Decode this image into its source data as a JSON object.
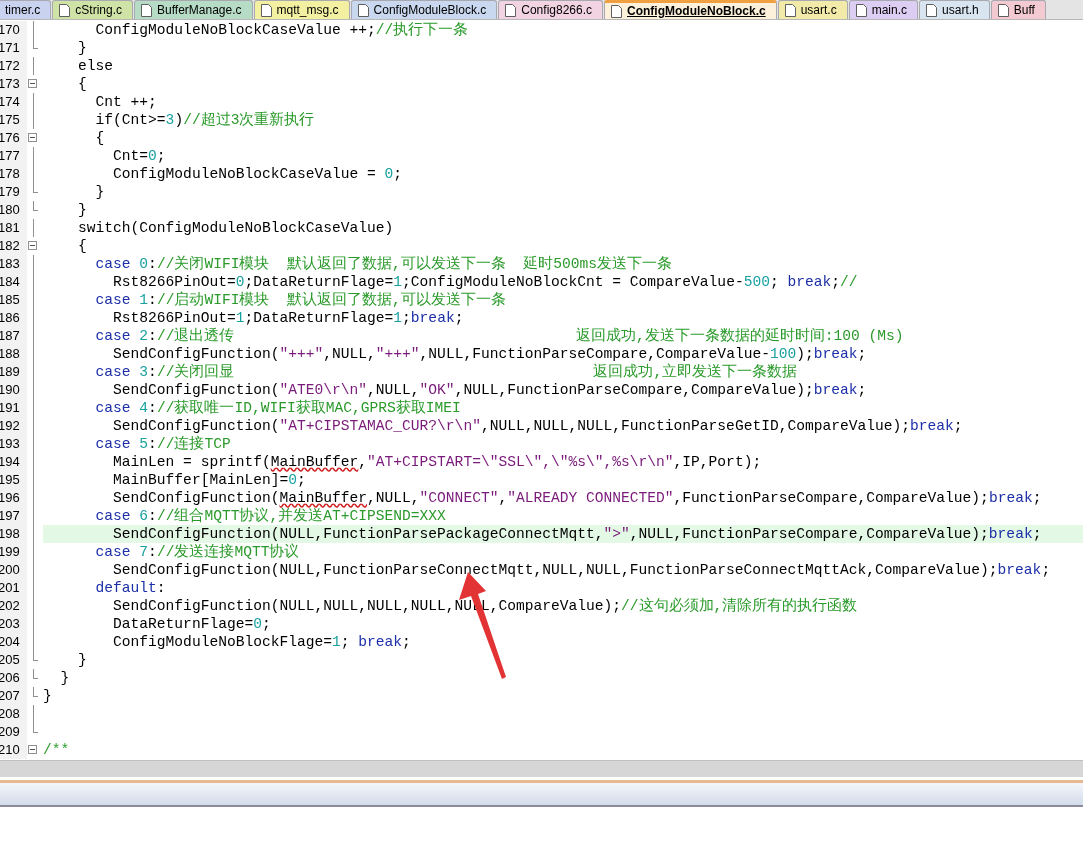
{
  "tabs": [
    {
      "label": "timer.c",
      "selected": false,
      "color": "#c9d3f0",
      "cut_left": true
    },
    {
      "label": "cString.c",
      "selected": false,
      "color": "#cfe3a6",
      "cut_left": false
    },
    {
      "label": "BufferManage.c",
      "selected": false,
      "color": "#b7dcc6",
      "cut_left": false
    },
    {
      "label": "mqtt_msg.c",
      "selected": false,
      "color": "#f3f0a2",
      "cut_left": false
    },
    {
      "label": "ConfigModuleBlock.c",
      "selected": false,
      "color": "#c9d8ef",
      "cut_left": false
    },
    {
      "label": "Config8266.c",
      "selected": false,
      "color": "#f1d3e2",
      "cut_left": false
    },
    {
      "label": "ConfigModuleNoBlock.c",
      "selected": true,
      "color": "#fdf1dc",
      "cut_left": false
    },
    {
      "label": "usart.c",
      "selected": false,
      "color": "#f2eaa9",
      "cut_left": false
    },
    {
      "label": "main.c",
      "selected": false,
      "color": "#dccdf2",
      "cut_left": false
    },
    {
      "label": "usart.h",
      "selected": false,
      "color": "#d9e4f1",
      "cut_left": false
    },
    {
      "label": "Buff",
      "selected": false,
      "color": "#f3c9d2",
      "cut_left": false
    }
  ],
  "editor": {
    "lines": [
      {
        "number": "170",
        "kind": "line",
        "highlighted": false,
        "segments": [
          {
            "kind": "code",
            "text": "      ConfigModuleNoBlockCaseValue ++;"
          },
          {
            "kind": "comment",
            "text": "//执行下一条"
          }
        ]
      },
      {
        "number": "171",
        "kind": "end",
        "highlighted": false,
        "segments": [
          {
            "kind": "code",
            "text": "    }"
          }
        ]
      },
      {
        "number": "172",
        "kind": "line",
        "highlighted": false,
        "segments": [
          {
            "kind": "code",
            "text": "    else"
          }
        ]
      },
      {
        "number": "173",
        "kind": "open",
        "highlighted": false,
        "segments": [
          {
            "kind": "code",
            "text": "    {"
          }
        ]
      },
      {
        "number": "174",
        "kind": "line",
        "highlighted": false,
        "segments": [
          {
            "kind": "code",
            "text": "      Cnt ++;"
          }
        ]
      },
      {
        "number": "175",
        "kind": "line",
        "highlighted": false,
        "segments": [
          {
            "kind": "code",
            "text": "      if(Cnt>="
          },
          {
            "kind": "number",
            "text": "3"
          },
          {
            "kind": "code",
            "text": ")"
          },
          {
            "kind": "comment",
            "text": "//超过3次重新执行"
          }
        ]
      },
      {
        "number": "176",
        "kind": "open",
        "highlighted": false,
        "segments": [
          {
            "kind": "code",
            "text": "      {"
          }
        ]
      },
      {
        "number": "177",
        "kind": "line",
        "highlighted": false,
        "segments": [
          {
            "kind": "code",
            "text": "        Cnt="
          },
          {
            "kind": "number",
            "text": "0"
          },
          {
            "kind": "code",
            "text": ";"
          }
        ]
      },
      {
        "number": "178",
        "kind": "line",
        "highlighted": false,
        "segments": [
          {
            "kind": "code",
            "text": "        ConfigModuleNoBlockCaseValue = "
          },
          {
            "kind": "number",
            "text": "0"
          },
          {
            "kind": "code",
            "text": ";"
          }
        ]
      },
      {
        "number": "179",
        "kind": "end",
        "highlighted": false,
        "segments": [
          {
            "kind": "code",
            "text": "      }"
          }
        ]
      },
      {
        "number": "180",
        "kind": "end",
        "highlighted": false,
        "segments": [
          {
            "kind": "code",
            "text": "    }"
          }
        ]
      },
      {
        "number": "181",
        "kind": "line",
        "highlighted": false,
        "segments": [
          {
            "kind": "code",
            "text": "    switch(ConfigModuleNoBlockCaseValue)"
          }
        ]
      },
      {
        "number": "182",
        "kind": "open",
        "highlighted": false,
        "segments": [
          {
            "kind": "code",
            "text": "    {"
          }
        ]
      },
      {
        "number": "183",
        "kind": "line",
        "highlighted": false,
        "segments": [
          {
            "kind": "keyword",
            "text": "      case "
          },
          {
            "kind": "number",
            "text": "0"
          },
          {
            "kind": "code",
            "text": ":"
          },
          {
            "kind": "comment",
            "text": "//关闭WIFI模块  默认返回了数据,可以发送下一条  延时500ms发送下一条"
          }
        ]
      },
      {
        "number": "184",
        "kind": "line",
        "highlighted": false,
        "segments": [
          {
            "kind": "code",
            "text": "        Rst8266PinOut="
          },
          {
            "kind": "number",
            "text": "0"
          },
          {
            "kind": "code",
            "text": ";DataReturnFlage="
          },
          {
            "kind": "number",
            "text": "1"
          },
          {
            "kind": "code",
            "text": ";ConfigModuleNoBlockCnt = CompareValue-"
          },
          {
            "kind": "number",
            "text": "500"
          },
          {
            "kind": "code",
            "text": "; "
          },
          {
            "kind": "keyword",
            "text": "break"
          },
          {
            "kind": "code",
            "text": ";"
          },
          {
            "kind": "comment",
            "text": "//"
          }
        ]
      },
      {
        "number": "185",
        "kind": "line",
        "highlighted": false,
        "segments": [
          {
            "kind": "keyword",
            "text": "      case "
          },
          {
            "kind": "number",
            "text": "1"
          },
          {
            "kind": "code",
            "text": ":"
          },
          {
            "kind": "comment",
            "text": "//启动WIFI模块  默认返回了数据,可以发送下一条"
          }
        ]
      },
      {
        "number": "186",
        "kind": "line",
        "highlighted": false,
        "segments": [
          {
            "kind": "code",
            "text": "        Rst8266PinOut="
          },
          {
            "kind": "number",
            "text": "1"
          },
          {
            "kind": "code",
            "text": ";DataReturnFlage="
          },
          {
            "kind": "number",
            "text": "1"
          },
          {
            "kind": "code",
            "text": ";"
          },
          {
            "kind": "keyword",
            "text": "break"
          },
          {
            "kind": "code",
            "text": ";"
          }
        ]
      },
      {
        "number": "187",
        "kind": "line",
        "highlighted": false,
        "segments": [
          {
            "kind": "keyword",
            "text": "      case "
          },
          {
            "kind": "number",
            "text": "2"
          },
          {
            "kind": "code",
            "text": ":"
          },
          {
            "kind": "comment",
            "text": "//退出透传                                       返回成功,发送下一条数据的延时时间:100 (Ms)"
          }
        ]
      },
      {
        "number": "188",
        "kind": "line",
        "highlighted": false,
        "segments": [
          {
            "kind": "code",
            "text": "        SendConfigFunction("
          },
          {
            "kind": "string",
            "text": "\"+++\""
          },
          {
            "kind": "code",
            "text": ",NULL,"
          },
          {
            "kind": "string",
            "text": "\"+++\""
          },
          {
            "kind": "code",
            "text": ",NULL,FunctionParseCompare,CompareValue-"
          },
          {
            "kind": "number",
            "text": "100"
          },
          {
            "kind": "code",
            "text": ");"
          },
          {
            "kind": "keyword",
            "text": "break"
          },
          {
            "kind": "code",
            "text": ";"
          }
        ]
      },
      {
        "number": "189",
        "kind": "line",
        "highlighted": false,
        "segments": [
          {
            "kind": "keyword",
            "text": "      case "
          },
          {
            "kind": "number",
            "text": "3"
          },
          {
            "kind": "code",
            "text": ":"
          },
          {
            "kind": "comment",
            "text": "//关闭回显                                         返回成功,立即发送下一条数据"
          }
        ]
      },
      {
        "number": "190",
        "kind": "line",
        "highlighted": false,
        "segments": [
          {
            "kind": "code",
            "text": "        SendConfigFunction("
          },
          {
            "kind": "string",
            "text": "\"ATE0\\r\\n\""
          },
          {
            "kind": "code",
            "text": ",NULL,"
          },
          {
            "kind": "string",
            "text": "\"OK\""
          },
          {
            "kind": "code",
            "text": ",NULL,FunctionParseCompare,CompareValue);"
          },
          {
            "kind": "keyword",
            "text": "break"
          },
          {
            "kind": "code",
            "text": ";"
          }
        ]
      },
      {
        "number": "191",
        "kind": "line",
        "highlighted": false,
        "segments": [
          {
            "kind": "keyword",
            "text": "      case "
          },
          {
            "kind": "number",
            "text": "4"
          },
          {
            "kind": "code",
            "text": ":"
          },
          {
            "kind": "comment",
            "text": "//获取唯一ID,WIFI获取MAC,GPRS获取IMEI"
          }
        ]
      },
      {
        "number": "192",
        "kind": "line",
        "highlighted": false,
        "segments": [
          {
            "kind": "code",
            "text": "        SendConfigFunction("
          },
          {
            "kind": "string",
            "text": "\"AT+CIPSTAMAC_CUR?\\r\\n\""
          },
          {
            "kind": "code",
            "text": ",NULL,NULL,NULL,FunctionParseGetID,CompareValue);"
          },
          {
            "kind": "keyword",
            "text": "break"
          },
          {
            "kind": "code",
            "text": ";"
          }
        ]
      },
      {
        "number": "193",
        "kind": "line",
        "highlighted": false,
        "segments": [
          {
            "kind": "keyword",
            "text": "      case "
          },
          {
            "kind": "number",
            "text": "5"
          },
          {
            "kind": "code",
            "text": ":"
          },
          {
            "kind": "comment",
            "text": "//连接TCP"
          }
        ]
      },
      {
        "number": "194",
        "kind": "line",
        "highlighted": false,
        "segments": [
          {
            "kind": "code",
            "text": "        MainLen = sprintf("
          },
          {
            "kind": "misspelled",
            "text": "MainBuffer"
          },
          {
            "kind": "code",
            "text": ","
          },
          {
            "kind": "string",
            "text": "\"AT+CIPSTART=\\\"SSL\\\",\\\"%s\\\",%s\\r\\n\""
          },
          {
            "kind": "code",
            "text": ",IP,Port);"
          }
        ]
      },
      {
        "number": "195",
        "kind": "line",
        "highlighted": false,
        "segments": [
          {
            "kind": "code",
            "text": "        MainBuffer[MainLen]="
          },
          {
            "kind": "number",
            "text": "0"
          },
          {
            "kind": "code",
            "text": ";"
          }
        ]
      },
      {
        "number": "196",
        "kind": "line",
        "highlighted": false,
        "segments": [
          {
            "kind": "code",
            "text": "        SendConfigFunction("
          },
          {
            "kind": "misspelled",
            "text": "MainBuffer"
          },
          {
            "kind": "code",
            "text": ",NULL,"
          },
          {
            "kind": "string",
            "text": "\"CONNECT\""
          },
          {
            "kind": "code",
            "text": ","
          },
          {
            "kind": "string",
            "text": "\"ALREADY CONNECTED\""
          },
          {
            "kind": "code",
            "text": ",FunctionParseCompare,CompareValue);"
          },
          {
            "kind": "keyword",
            "text": "break"
          },
          {
            "kind": "code",
            "text": ";"
          }
        ]
      },
      {
        "number": "197",
        "kind": "line",
        "highlighted": false,
        "segments": [
          {
            "kind": "keyword",
            "text": "      case "
          },
          {
            "kind": "number",
            "text": "6"
          },
          {
            "kind": "code",
            "text": ":"
          },
          {
            "kind": "comment",
            "text": "//组合MQTT协议,并发送AT+CIPSEND=XXX"
          }
        ]
      },
      {
        "number": "198",
        "kind": "line",
        "highlighted": true,
        "segments": [
          {
            "kind": "code",
            "text": "        SendConfigFunction(NULL,FunctionParsePackageConnectMqtt,"
          },
          {
            "kind": "string",
            "text": "\">\""
          },
          {
            "kind": "code",
            "text": ",NULL,FunctionParseCompare,CompareValue);"
          },
          {
            "kind": "keyword",
            "text": "break"
          },
          {
            "kind": "code",
            "text": ";"
          }
        ]
      },
      {
        "number": "199",
        "kind": "line",
        "highlighted": false,
        "segments": [
          {
            "kind": "keyword",
            "text": "      case "
          },
          {
            "kind": "number",
            "text": "7"
          },
          {
            "kind": "code",
            "text": ":"
          },
          {
            "kind": "comment",
            "text": "//发送连接MQTT协议"
          }
        ]
      },
      {
        "number": "200",
        "kind": "line",
        "highlighted": false,
        "segments": [
          {
            "kind": "code",
            "text": "        SendConfigFunction(NULL,FunctionParseConnectMqtt,NULL,NULL,FunctionParseConnectMqttAck,CompareValue);"
          },
          {
            "kind": "keyword",
            "text": "break"
          },
          {
            "kind": "code",
            "text": ";"
          }
        ]
      },
      {
        "number": "201",
        "kind": "line",
        "highlighted": false,
        "segments": [
          {
            "kind": "keyword",
            "text": "      default"
          },
          {
            "kind": "code",
            "text": ":"
          }
        ]
      },
      {
        "number": "202",
        "kind": "line",
        "highlighted": false,
        "segments": [
          {
            "kind": "code",
            "text": "        SendConfigFunction(NULL,NULL,NULL,NULL,NULL,CompareValue);"
          },
          {
            "kind": "comment",
            "text": "//这句必须加,清除所有的执行函数"
          }
        ]
      },
      {
        "number": "203",
        "kind": "line",
        "highlighted": false,
        "segments": [
          {
            "kind": "code",
            "text": "        DataReturnFlage="
          },
          {
            "kind": "number",
            "text": "0"
          },
          {
            "kind": "code",
            "text": ";"
          }
        ]
      },
      {
        "number": "204",
        "kind": "line",
        "highlighted": false,
        "segments": [
          {
            "kind": "code",
            "text": "        ConfigModuleNoBlockFlage="
          },
          {
            "kind": "number",
            "text": "1"
          },
          {
            "kind": "code",
            "text": "; "
          },
          {
            "kind": "keyword",
            "text": "break"
          },
          {
            "kind": "code",
            "text": ";"
          }
        ]
      },
      {
        "number": "205",
        "kind": "end",
        "highlighted": false,
        "segments": [
          {
            "kind": "code",
            "text": "    }"
          }
        ]
      },
      {
        "number": "206",
        "kind": "end",
        "highlighted": false,
        "segments": [
          {
            "kind": "code",
            "text": "  }"
          }
        ]
      },
      {
        "number": "207",
        "kind": "end",
        "highlighted": false,
        "segments": [
          {
            "kind": "code",
            "text": "}"
          }
        ]
      },
      {
        "number": "208",
        "kind": "line",
        "highlighted": false
      },
      {
        "number": "209",
        "kind": "end",
        "highlighted": false
      },
      {
        "number": "210",
        "kind": "open",
        "highlighted": false,
        "segments": [
          {
            "kind": "comment",
            "text": "/**"
          }
        ]
      }
    ]
  }
}
